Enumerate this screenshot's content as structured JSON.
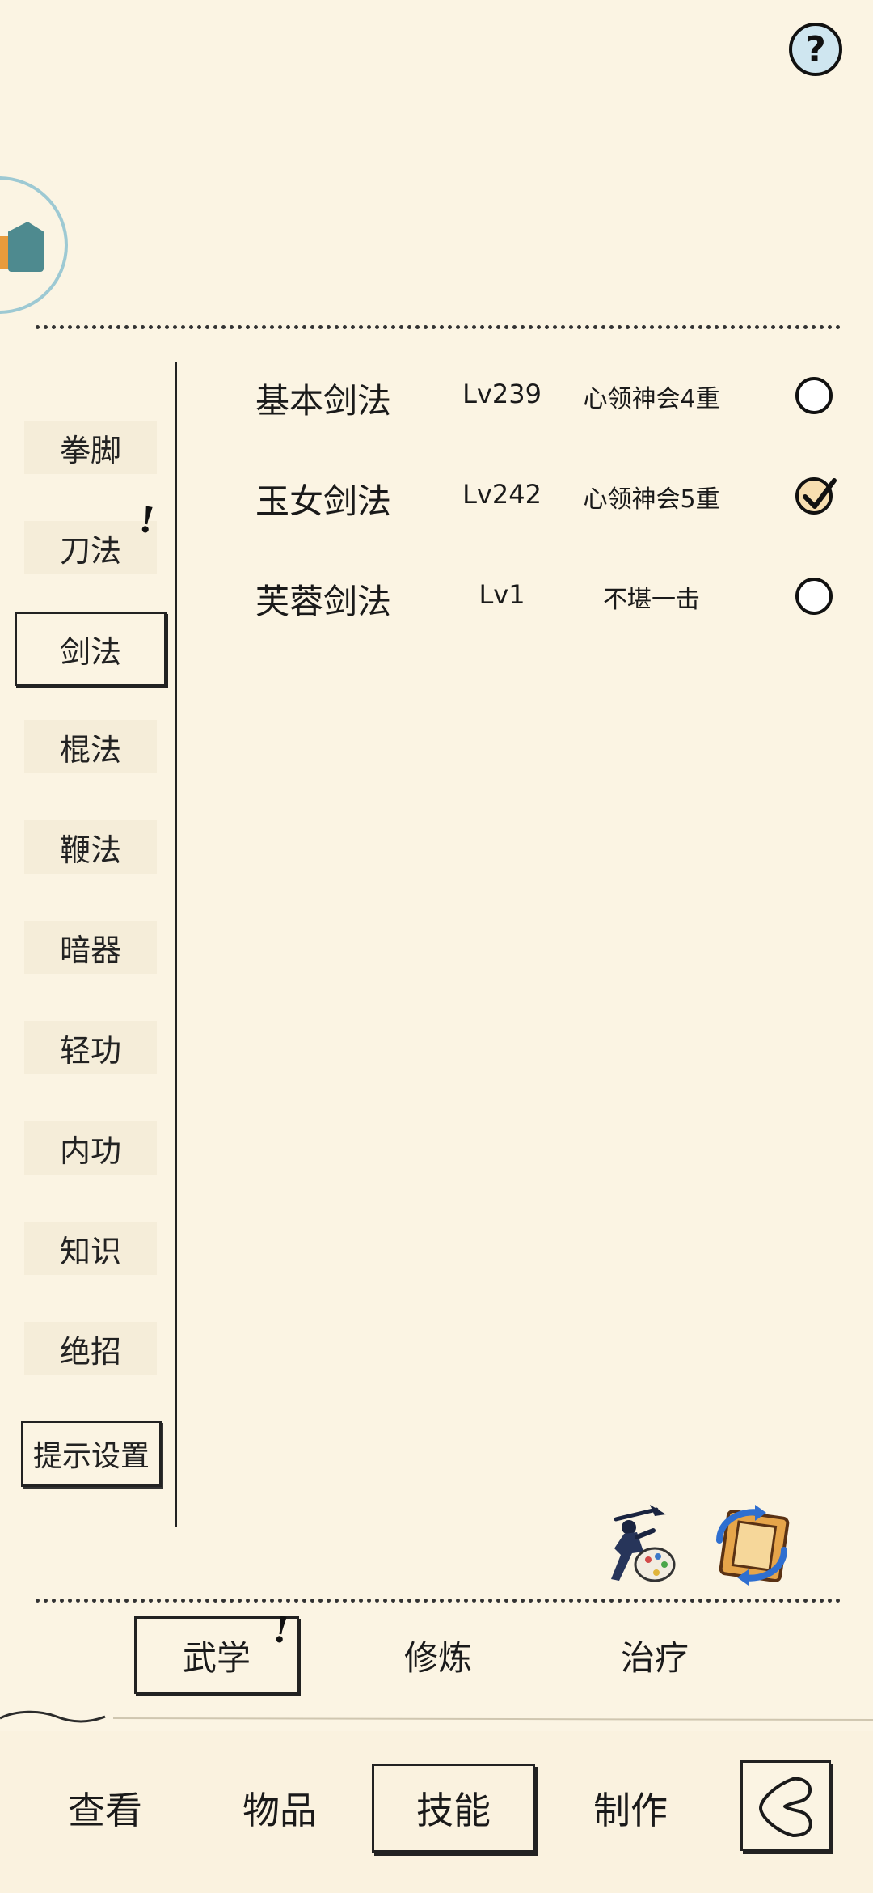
{
  "help": {
    "icon": "question-icon",
    "glyph": "?"
  },
  "sidebar": {
    "items": [
      {
        "label": "拳脚"
      },
      {
        "label": "刀法",
        "alert": "!"
      },
      {
        "label": "剑法",
        "selected": true
      },
      {
        "label": "棍法"
      },
      {
        "label": "鞭法"
      },
      {
        "label": "暗器"
      },
      {
        "label": "轻功"
      },
      {
        "label": "内功"
      },
      {
        "label": "知识"
      },
      {
        "label": "绝招"
      }
    ],
    "settings_label": "提示设置"
  },
  "skills": [
    {
      "name": "基本剑法",
      "level": "Lv239",
      "state": "心领神会4重",
      "checked": false
    },
    {
      "name": "玉女剑法",
      "level": "Lv242",
      "state": "心领神会5重",
      "checked": true
    },
    {
      "name": "芙蓉剑法",
      "level": "Lv1",
      "state": "不堪一击",
      "checked": false
    }
  ],
  "subtabs": [
    {
      "label": "武学",
      "alert": "!",
      "active": true
    },
    {
      "label": "修炼"
    },
    {
      "label": "治疗"
    }
  ],
  "bottom_nav": [
    {
      "label": "查看"
    },
    {
      "label": "物品"
    },
    {
      "label": "技能",
      "active": true
    },
    {
      "label": "制作"
    }
  ],
  "colors": {
    "background": "#fbf4e3",
    "ink": "#1a1a1a",
    "help_fill": "#cfe6f0",
    "check_fill": "#f7deb0"
  }
}
